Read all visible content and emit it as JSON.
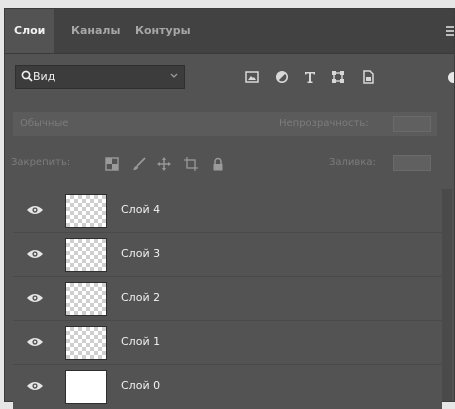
{
  "tabs": [
    {
      "label": "Слои",
      "active": true
    },
    {
      "label": "Каналы",
      "active": false
    },
    {
      "label": "Контуры",
      "active": false
    }
  ],
  "filter": {
    "label": "Вид",
    "icons": [
      "image-filter-icon",
      "adjustment-filter-icon",
      "type-filter-icon",
      "shape-filter-icon",
      "smart-object-filter-icon"
    ]
  },
  "blend": {
    "mode": "Обычные",
    "opacity_label": "Непрозрачность:"
  },
  "lock": {
    "label": "Закрепить:",
    "fill_label": "Заливка:"
  },
  "layers": [
    {
      "name": "Слой 4",
      "visible": true,
      "thumbnail": "transparent"
    },
    {
      "name": "Слой 3",
      "visible": true,
      "thumbnail": "transparent"
    },
    {
      "name": "Слой 2",
      "visible": true,
      "thumbnail": "transparent"
    },
    {
      "name": "Слой 1",
      "visible": true,
      "thumbnail": "transparent"
    },
    {
      "name": "Слой 0",
      "visible": true,
      "thumbnail": "white"
    }
  ],
  "colors": {
    "panel_bg": "#535353",
    "tabbar_bg": "#424242",
    "text_primary": "#f2f2f2",
    "text_inactive": "#a7a7a7"
  }
}
